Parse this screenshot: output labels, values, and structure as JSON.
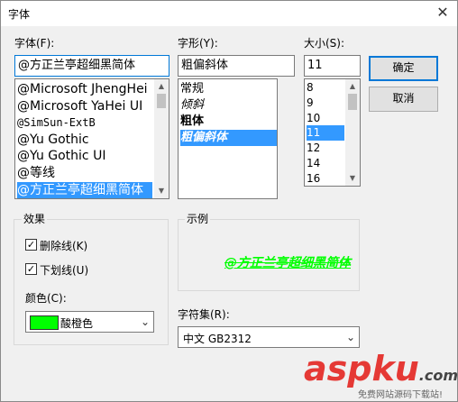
{
  "window": {
    "title": "字体"
  },
  "font": {
    "label": "字体(F):",
    "value": "@方正兰亭超细黑简体",
    "items": [
      {
        "name": "@Microsoft JhengHei l"
      },
      {
        "name": "@Microsoft YaHei UI"
      },
      {
        "name": "@SimSun-ExtB"
      },
      {
        "name": "@Yu Gothic"
      },
      {
        "name": "@Yu Gothic UI"
      },
      {
        "name": "@等线"
      },
      {
        "name": "@方正兰亭超细黑简体"
      }
    ],
    "selected_index": 6
  },
  "style": {
    "label": "字形(Y):",
    "value": "粗偏斜体",
    "items": [
      {
        "name": "常规"
      },
      {
        "name": "倾斜"
      },
      {
        "name": "粗体"
      },
      {
        "name": "粗偏斜体"
      }
    ],
    "selected_index": 3
  },
  "size": {
    "label": "大小(S):",
    "value": "11",
    "items": [
      "8",
      "9",
      "10",
      "11",
      "12",
      "14",
      "16"
    ],
    "selected_index": 3
  },
  "buttons": {
    "ok": "确定",
    "cancel": "取消"
  },
  "effects": {
    "label": "效果",
    "strikeout": {
      "label": "删除线(K)",
      "checked": true
    },
    "underline": {
      "label": "下划线(U)",
      "checked": true
    },
    "color_label": "颜色(C):",
    "color_value": "酸橙色",
    "color_hex": "#00ff00"
  },
  "sample": {
    "label": "示例"
  },
  "charset": {
    "label": "字符集(R):",
    "value": "中文 GB2312"
  },
  "watermark": {
    "logo": "aspku",
    "dotcom": ".com",
    "tagline": "免费网站源码下载站!"
  }
}
